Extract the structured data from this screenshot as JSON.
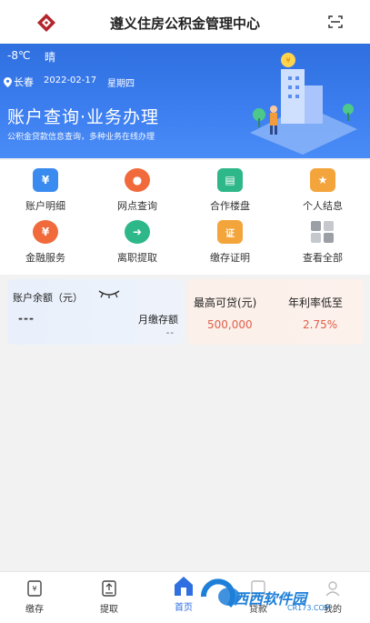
{
  "header": {
    "title": "遵义住房公积金管理中心",
    "logo_icon": "housing-fund-logo",
    "scan_icon": "scan-icon"
  },
  "banner": {
    "temperature": "-8℃",
    "weather": "晴",
    "location": "长春",
    "date": "2022-02-17",
    "weekday": "星期四",
    "headline": "账户查询·业务办理",
    "subline": "公积金贷款信息查询，多种业务在线办理",
    "colors": {
      "primary": "#2f6fe0"
    }
  },
  "services": [
    {
      "label": "账户明细",
      "icon": "yuan-card-icon",
      "color": "#3a8bf0"
    },
    {
      "label": "网点查询",
      "icon": "location-pin-icon",
      "color": "#f06a3c"
    },
    {
      "label": "合作楼盘",
      "icon": "building-icon",
      "color": "#2eb88a"
    },
    {
      "label": "个人结息",
      "icon": "star-box-icon",
      "color": "#f3a53c"
    },
    {
      "label": "金融服务",
      "icon": "money-hand-icon",
      "color": "#f06a3c"
    },
    {
      "label": "离职提取",
      "icon": "person-exit-icon",
      "color": "#2eb88a"
    },
    {
      "label": "缴存证明",
      "icon": "certificate-icon",
      "color": "#f3a53c"
    },
    {
      "label": "查看全部",
      "icon": "grid-all-icon",
      "color": "#9aa0a6"
    }
  ],
  "account": {
    "balance_label": "账户余额（元）",
    "balance_value": "---",
    "monthly_label": "月缴存额",
    "monthly_value": "--"
  },
  "loan": {
    "max_label": "最高可贷(元)",
    "max_value": "500,000",
    "rate_label": "年利率低至",
    "rate_value": "2.75%"
  },
  "tabbar": {
    "tabs": [
      {
        "label": "缴存",
        "icon": "deposit-icon"
      },
      {
        "label": "提取",
        "icon": "withdraw-icon"
      },
      {
        "label": "首页",
        "icon": "home-icon"
      },
      {
        "label": "贷款",
        "icon": "loan-icon"
      },
      {
        "label": "我的",
        "icon": "profile-icon"
      }
    ]
  },
  "watermark": {
    "text": "西西软件园",
    "url": "CR173.COM"
  }
}
